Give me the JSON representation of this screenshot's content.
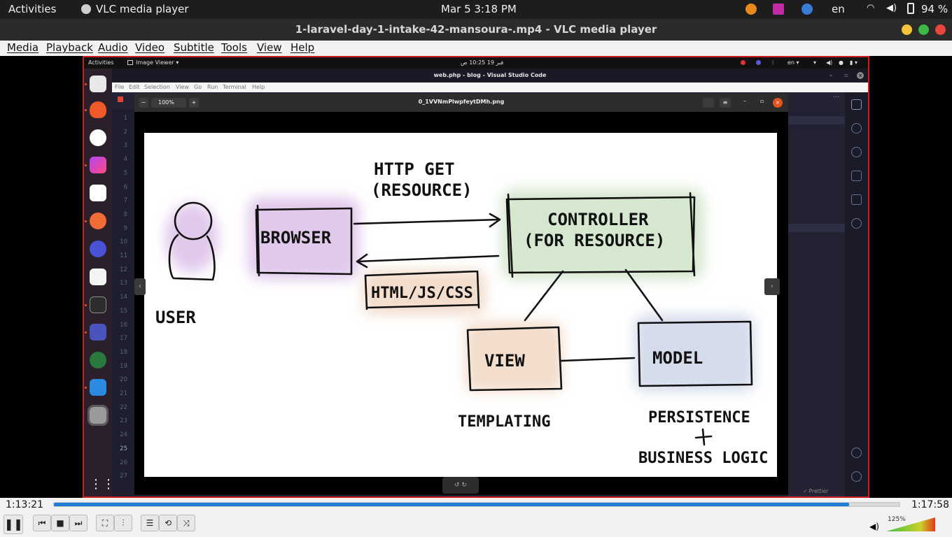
{
  "topbar": {
    "activities": "Activities",
    "app": "VLC media player",
    "clock": "Mar 5   3:18 PM",
    "lang": "en",
    "battery": "94 %"
  },
  "vlc": {
    "title": "1-laravel-day-1-intake-42-mansoura-.mp4 - VLC media player",
    "menu": [
      "Media",
      "Playback",
      "Audio",
      "Video",
      "Subtitle",
      "Tools",
      "View",
      "Help"
    ],
    "elapsed": "1:13:21",
    "total": "1:17:58",
    "progress": 0.94,
    "volume": "125%"
  },
  "inner": {
    "activities": "Activities",
    "app": "Image Viewer ▾",
    "clock": "فبر 19  10:25 ص",
    "lang": "en ▾",
    "vscode_title": "web.php - blog - Visual Studio Code",
    "vscode_menu": [
      "File",
      "Edit",
      "Selection",
      "View",
      "Go",
      "Run",
      "Terminal",
      "Help"
    ],
    "line_numbers": [
      "1",
      "2",
      "3",
      "4",
      "5",
      "6",
      "7",
      "8",
      "9",
      "10",
      "11",
      "12",
      "13",
      "14",
      "15",
      "16",
      "17",
      "18",
      "19",
      "20",
      "21",
      "22",
      "23",
      "24",
      "25",
      "26",
      "27"
    ],
    "image_viewer": {
      "zoom": "100%",
      "filename": "0_1VVNmPlwpfeytDMh.png"
    },
    "status_prettier": "✓ Prettier"
  },
  "diagram": {
    "http_get": "HTTP GET",
    "resource": "(RESOURCE)",
    "browser": "BROWSER",
    "controller": "CONTROLLER",
    "controller_sub": "(FOR RESOURCE)",
    "html_js_css": "HTML/JS/CSS",
    "user": "USER",
    "view": "VIEW",
    "model": "MODEL",
    "templating": "TEMPLATING",
    "persistence": "PERSISTENCE",
    "plus": "+",
    "business_logic": "BUSINESS LOGIC"
  },
  "colors": {
    "accent_red": "#c81e1e",
    "progress_blue": "#1c7ed6",
    "browser_tint": "#d8b7e6",
    "controller_tint": "#c8dfbe",
    "view_tint": "#efd2bb",
    "model_tint": "#c6d0e5"
  }
}
